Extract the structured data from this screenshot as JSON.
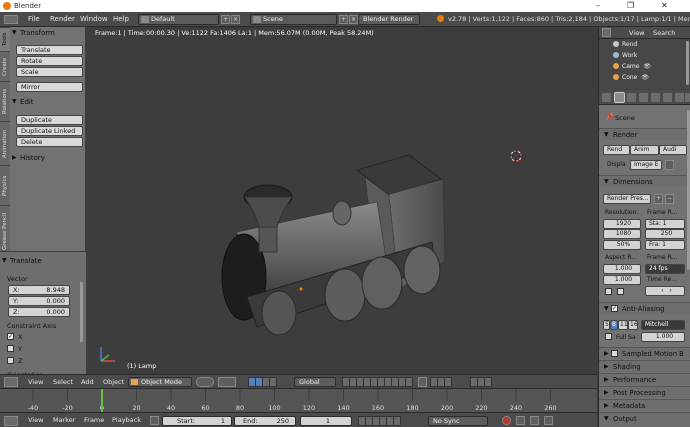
{
  "window": {
    "title": "Blender",
    "controls": [
      "–",
      "❐",
      "✕"
    ]
  },
  "info_header": {
    "menus": [
      "File",
      "Render",
      "Window",
      "Help"
    ],
    "layout": "Default",
    "scene": "Scene",
    "engine": "Blender Render",
    "stats": "v2.78 | Verts:1,122 | Faces:860 | Tris:2,184 | Objects:1/17 | Lamp:1/1 | Mem:45.23M"
  },
  "toolshelf": {
    "tabs": [
      "Tools",
      "Create",
      "Relations",
      "Animation",
      "Physics",
      "Grease Pencil"
    ],
    "transform": {
      "title": "Transform",
      "buttons": [
        "Translate",
        "Rotate",
        "Scale",
        "Mirror"
      ]
    },
    "edit": {
      "title": "Edit",
      "buttons": [
        "Duplicate",
        "Duplicate Linked",
        "Delete"
      ]
    },
    "history": {
      "title": "History"
    },
    "operator": {
      "title": "Translate",
      "vector_label": "Vector",
      "x_label": "X:",
      "x_value": "8.948",
      "y_label": "Y:",
      "y_value": "0.000",
      "z_label": "Z:",
      "z_value": "0.000",
      "constraint_label": "Constraint Axis",
      "axes": [
        {
          "label": "X",
          "checked": true
        },
        {
          "label": "Y",
          "checked": false
        },
        {
          "label": "Z",
          "checked": false
        }
      ],
      "orientation_label": "Orientation"
    }
  },
  "viewport": {
    "info": "Frame:1 | Time:00:00.30 | Ve:1122 Fa:1406 La:1 | Mem:56.07M (0.00M, Peak 58.24M)",
    "object_name": "(1) Lamp"
  },
  "view_header": {
    "menus": [
      "View",
      "Select",
      "Add",
      "Object"
    ],
    "mode": "Object Mode",
    "orientation": "Global"
  },
  "timeline": {
    "ticks": [
      "-40",
      "-20",
      "0",
      "20",
      "40",
      "60",
      "80",
      "100",
      "120",
      "140",
      "160",
      "180",
      "200",
      "220",
      "240",
      "260"
    ],
    "current_frame": 0,
    "menus": [
      "View",
      "Marker",
      "Frame",
      "Playback"
    ],
    "start_label": "Start:",
    "start_value": "1",
    "end_label": "End:",
    "end_value": "250",
    "frame_value": "1",
    "sync": "No Sync"
  },
  "outliner": {
    "menus": [
      "View",
      "Search"
    ],
    "rows": [
      {
        "label": "Rend",
        "color": "#c8c8c8"
      },
      {
        "label": "Work",
        "color": "#9bbcd6"
      },
      {
        "label": "Came",
        "color": "#e8a24b"
      },
      {
        "label": "Cone",
        "color": "#e8a24b"
      }
    ]
  },
  "properties": {
    "scene_label": "Scene",
    "render": {
      "title": "Render",
      "buttons": [
        "Rend",
        "Anim",
        "Audi"
      ],
      "display_label": "Displa",
      "display_value": "Image E"
    },
    "dimensions": {
      "title": "Dimensions",
      "presets": "Render Pres...",
      "resolution_label": "Resolution:",
      "res_x": "1920",
      "res_y": "1080",
      "res_pct": "50%",
      "frame_range_label": "Frame R...",
      "frame_start": "Sta: 1",
      "frame_end": "250",
      "frame_step": "Fra: 1",
      "aspect_label": "Aspect R...",
      "aspect_x": "1.000",
      "aspect_y": "1.000",
      "frame_rate_label": "Frame R...",
      "fps": "24 fps",
      "time_label": "Time Re..."
    },
    "antialiasing": {
      "title": "Anti-Aliasing",
      "samples": [
        "5",
        "8",
        "11",
        "16"
      ],
      "filter": "Mitchell",
      "full_label": "Full Sa",
      "filter_size": "1.000"
    },
    "collapsed": [
      "Sampled Motion B",
      "Shading",
      "Performance",
      "Post Processing",
      "Metadata",
      "Output"
    ]
  },
  "colors": {
    "accent": "#5680c2",
    "viewport_bg": "#3d3d3d",
    "panel_bg": "#727272"
  }
}
